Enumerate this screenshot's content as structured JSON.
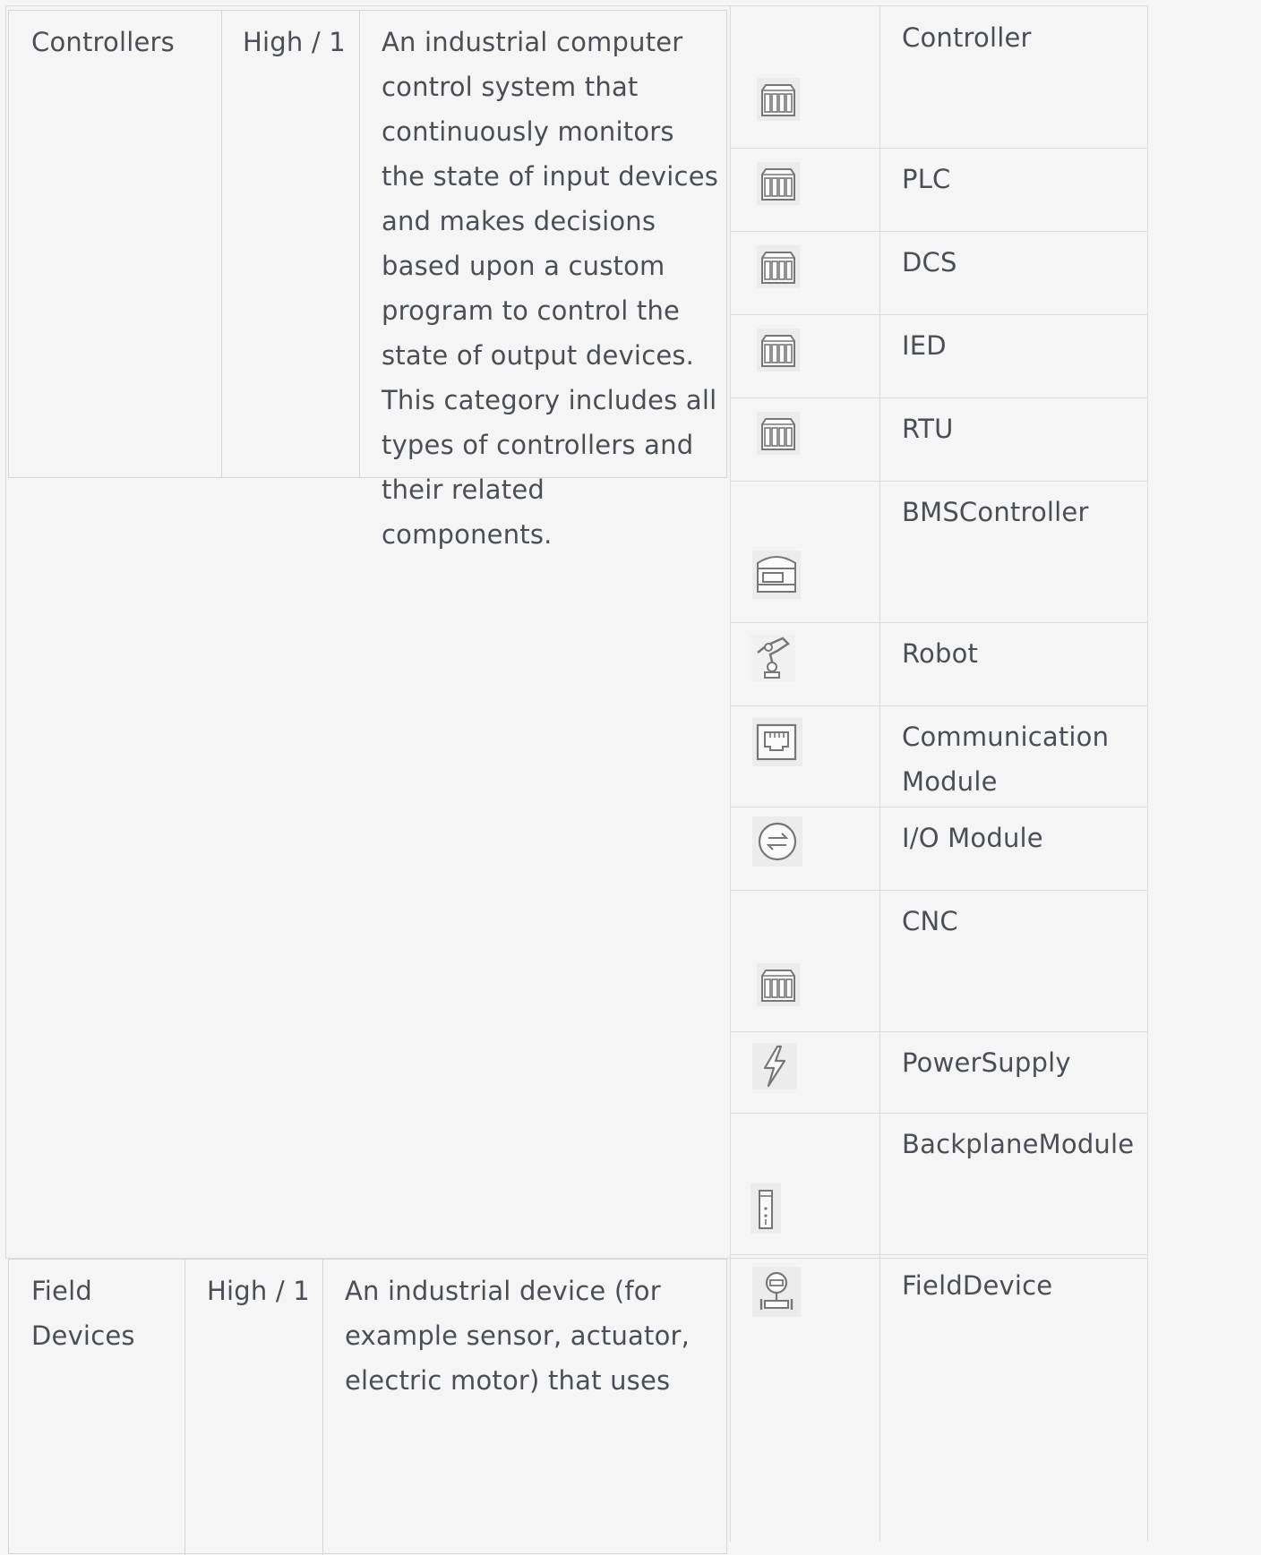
{
  "rows": [
    {
      "category": "Controllers",
      "risk": "High / 1",
      "description": "An industrial computer control system that continuously monitors the state of input devices and makes decisions based upon a custom program to control the state of output devices. This category includes all types of controllers and their related components."
    },
    {
      "category": "Field Devices",
      "risk": "High / 1",
      "description": "An industrial device (for example sensor, actuator, electric motor) that uses"
    }
  ],
  "device_types": [
    {
      "label": "Controller",
      "icon": "plc-rack-icon"
    },
    {
      "label": "PLC",
      "icon": "plc-rack-icon"
    },
    {
      "label": "DCS",
      "icon": "plc-rack-icon"
    },
    {
      "label": "IED",
      "icon": "plc-rack-icon"
    },
    {
      "label": "RTU",
      "icon": "plc-rack-icon"
    },
    {
      "label": "BMSController",
      "icon": "bms-controller-icon"
    },
    {
      "label": "Robot",
      "icon": "robot-arm-icon"
    },
    {
      "label": "Communication Module",
      "icon": "network-port-icon"
    },
    {
      "label": "I/O Module",
      "icon": "io-exchange-icon"
    },
    {
      "label": "CNC",
      "icon": "plc-rack-icon"
    },
    {
      "label": "PowerSupply",
      "icon": "lightning-bolt-icon"
    },
    {
      "label": "BackplaneModule",
      "icon": "backplane-module-icon"
    },
    {
      "label": "FieldDevice",
      "icon": "field-device-icon"
    }
  ]
}
